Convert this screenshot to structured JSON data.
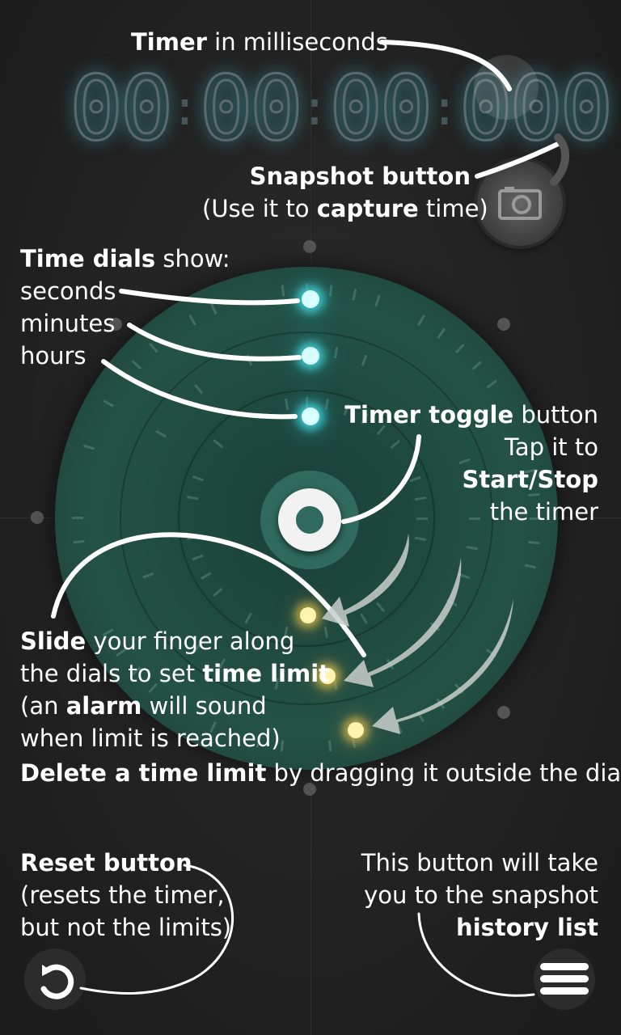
{
  "timer": {
    "d1": "00",
    "d2": "00",
    "d3": "00",
    "d4": "000",
    "sep": ":"
  },
  "labels": {
    "timer": {
      "bold": "Timer",
      "rest": " in milliseconds"
    },
    "snapshot": {
      "bold": "Snapshot button",
      "line2_pre": "(Use it to ",
      "line2_bold": "capture",
      "line2_post": " time)"
    },
    "dials": {
      "bold": "Time dials",
      "rest": " show:",
      "l1": "seconds",
      "l2": "minutes",
      "l3": "hours"
    },
    "toggle": {
      "bold": "Timer toggle",
      "rest": " button",
      "l2": "Tap it to",
      "l3_bold": "Start/Stop",
      "l4": "the timer"
    },
    "slide": {
      "bold": "Slide",
      "rest": " your finger along",
      "l2_pre": "the dials to set ",
      "l2_bold": "time limit",
      "l3_pre": "(an ",
      "l3_bold": "alarm",
      "l3_post": " will sound",
      "l4": "when limit is reached)"
    },
    "delete": {
      "bold": "Delete a time limit",
      "rest": " by dragging it outside the dials"
    },
    "reset": {
      "bold": "Reset button",
      "l2": "(resets the timer,",
      "l3": "but not the limits)"
    },
    "history": {
      "l1": "This button will take",
      "l2": "you to the snapshot",
      "l3_bold": "history list"
    }
  },
  "icons": {
    "snapshot": "camera-icon",
    "toggle": "ring-icon",
    "reset": "reset-icon",
    "menu": "menu-icon"
  },
  "colors": {
    "accent_cyan": "#46dce6",
    "accent_gold": "#f0c850",
    "dial": "#245247"
  }
}
